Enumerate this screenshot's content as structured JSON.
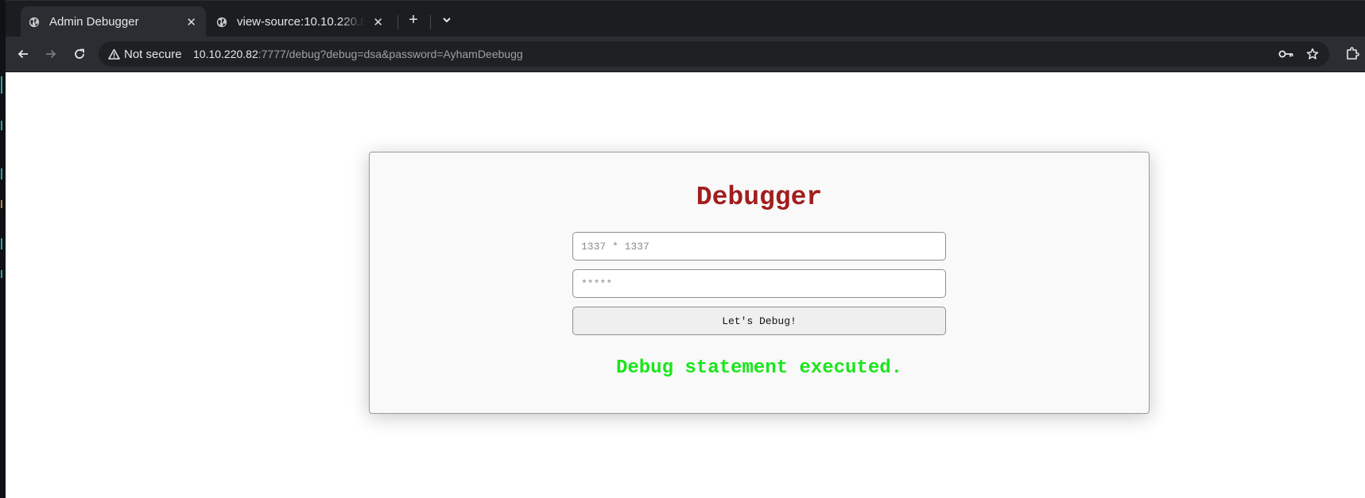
{
  "browser": {
    "tabs": [
      {
        "title": "Admin Debugger",
        "active": true,
        "icon": "globe-icon"
      },
      {
        "title": "view-source:10.10.220.82",
        "active": false,
        "icon": "globe-icon"
      }
    ],
    "security_label": "Not secure",
    "url": {
      "host": "10.10.220.82",
      "rest": ":7777/debug?debug=dsa&password=AyhamDeebugg"
    },
    "icons": [
      "back-icon",
      "forward-icon",
      "reload-icon",
      "warning-icon",
      "password-key-icon",
      "bookmark-star-icon",
      "extensions-icon"
    ]
  },
  "page": {
    "heading": "Debugger",
    "expression_input": {
      "placeholder": "1337 * 1337",
      "value": ""
    },
    "password_input": {
      "placeholder": "*****",
      "value": ""
    },
    "submit_label": "Let's Debug!",
    "result_message": "Debug statement executed."
  },
  "colors": {
    "heading": "#a21d1d",
    "result": "#1ae61a",
    "browser_chrome": "#2b2d32"
  }
}
